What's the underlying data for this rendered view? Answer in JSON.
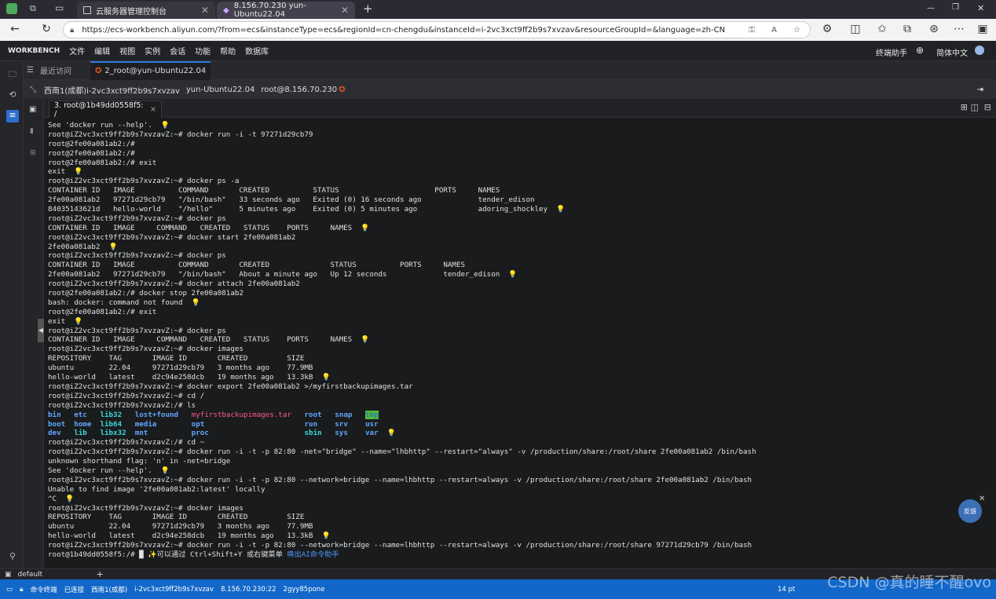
{
  "browser": {
    "tabs": [
      {
        "title": "云服务器管理控制台"
      },
      {
        "title": "8.156.70.230 yun-Ubuntu22.04"
      }
    ],
    "new_tab": "+",
    "window_controls": [
      "—",
      "❐",
      "✕"
    ],
    "url": "https://ecs-workbench.aliyun.com/?from=ecs&instanceType=ecs&regionId=cn-chengdu&instanceId=i-2vc3xct9ff2b9s7xvzav&resourceGroupId=&language=zh-CN"
  },
  "menubar": {
    "brand": "WORKBENCH",
    "items": [
      "文件",
      "编辑",
      "视图",
      "实例",
      "会话",
      "功能",
      "帮助",
      "数据库"
    ],
    "right": [
      "终端助手",
      "简体中文"
    ]
  },
  "session": {
    "recent": "最近访问",
    "tab": "2_root@yun-Ubuntu22.04"
  },
  "infobar": {
    "region": "西南1(成都)i-2vc3xct9ff2b9s7xvzav",
    "host": "yun-Ubuntu22.04",
    "user": "root@8.156.70.230"
  },
  "terminal_tab": {
    "label": "3. root@1b49dd0558f5: /",
    "close": "×"
  },
  "terminal": {
    "lines": [
      [
        {
          "t": "See 'docker run --help'.  "
        },
        {
          "t": "💡",
          "c": "bulb"
        }
      ],
      [
        {
          "t": "root@iZ2vc3xct9ff2b9s7xvzavZ:~# docker run -i -t 97271d29cb79"
        }
      ],
      [
        {
          "t": "root@2fe00a081ab2:/#"
        }
      ],
      [
        {
          "t": "root@2fe00a081ab2:/#"
        }
      ],
      [
        {
          "t": "root@2fe00a081ab2:/# exit"
        }
      ],
      [
        {
          "t": "exit  "
        },
        {
          "t": "💡",
          "c": "bulb"
        }
      ],
      [
        {
          "t": "root@iZ2vc3xct9ff2b9s7xvzavZ:~# docker ps -a"
        }
      ],
      [
        {
          "t": "CONTAINER ID   IMAGE          COMMAND       CREATED          STATUS                      PORTS     NAMES"
        }
      ],
      [
        {
          "t": "2fe00a081ab2   97271d29cb79   \"/bin/bash\"   33 seconds ago   Exited (0) 16 seconds ago             tender_edison"
        }
      ],
      [
        {
          "t": "84035143621d   hello-world    \"/hello\"      5 minutes ago    Exited (0) 5 minutes ago              adoring_shockley  "
        },
        {
          "t": "💡",
          "c": "bulb"
        }
      ],
      [
        {
          "t": "root@iZ2vc3xct9ff2b9s7xvzavZ:~# docker ps"
        }
      ],
      [
        {
          "t": "CONTAINER ID   IMAGE     COMMAND   CREATED   STATUS    PORTS     NAMES  "
        },
        {
          "t": "💡",
          "c": "bulb"
        }
      ],
      [
        {
          "t": "root@iZ2vc3xct9ff2b9s7xvzavZ:~# docker start 2fe00a081ab2"
        }
      ],
      [
        {
          "t": "2fe00a081ab2  "
        },
        {
          "t": "💡",
          "c": "bulb"
        }
      ],
      [
        {
          "t": "root@iZ2vc3xct9ff2b9s7xvzavZ:~# docker ps"
        }
      ],
      [
        {
          "t": "CONTAINER ID   IMAGE          COMMAND       CREATED              STATUS          PORTS     NAMES"
        }
      ],
      [
        {
          "t": "2fe00a081ab2   97271d29cb79   \"/bin/bash\"   About a minute ago   Up 12 seconds             tender_edison  "
        },
        {
          "t": "💡",
          "c": "bulb"
        }
      ],
      [
        {
          "t": "root@iZ2vc3xct9ff2b9s7xvzavZ:~# docker attach 2fe00a081ab2"
        }
      ],
      [
        {
          "t": "root@2fe00a081ab2:/# docker stop 2fe00a081ab2"
        }
      ],
      [
        {
          "t": "bash: docker: command not found  "
        },
        {
          "t": "💡",
          "c": "bulb"
        }
      ],
      [
        {
          "t": "root@2fe00a081ab2:/# exit"
        }
      ],
      [
        {
          "t": "exit  "
        },
        {
          "t": "💡",
          "c": "bulb"
        }
      ],
      [
        {
          "t": "root@iZ2vc3xct9ff2b9s7xvzavZ:~# docker ps"
        }
      ],
      [
        {
          "t": "CONTAINER ID   IMAGE     COMMAND   CREATED   STATUS    PORTS     NAMES  "
        },
        {
          "t": "💡",
          "c": "bulb"
        }
      ],
      [
        {
          "t": "root@iZ2vc3xct9ff2b9s7xvzavZ:~# docker images"
        }
      ],
      [
        {
          "t": "REPOSITORY    TAG       IMAGE ID       CREATED         SIZE"
        }
      ],
      [
        {
          "t": "ubuntu        22.04     97271d29cb79   3 months ago    77.9MB"
        }
      ],
      [
        {
          "t": "hello-world   latest    d2c94e258dcb   19 months ago   13.3kB  "
        },
        {
          "t": "💡",
          "c": "bulb"
        }
      ],
      [
        {
          "t": "root@iZ2vc3xct9ff2b9s7xvzavZ:~# docker export 2fe00a081ab2 >/myfirstbackupimages.tar"
        }
      ],
      [
        {
          "t": "root@iZ2vc3xct9ff2b9s7xvzavZ:~# cd /"
        }
      ],
      [
        {
          "t": "root@iZ2vc3xct9ff2b9s7xvzavZ:/# ls"
        }
      ],
      [
        {
          "t": "bin",
          "c": "dir"
        },
        {
          "t": "   "
        },
        {
          "t": "etc",
          "c": "dir"
        },
        {
          "t": "   "
        },
        {
          "t": "lib32",
          "c": "cyan"
        },
        {
          "t": "   "
        },
        {
          "t": "lost+found",
          "c": "dir"
        },
        {
          "t": "   "
        },
        {
          "t": "myfirstbackupimages.tar",
          "c": "red"
        },
        {
          "t": "   "
        },
        {
          "t": "root",
          "c": "dir"
        },
        {
          "t": "   "
        },
        {
          "t": "snap",
          "c": "dir"
        },
        {
          "t": "   "
        },
        {
          "t": "tmp",
          "c": "hl"
        }
      ],
      [
        {
          "t": "boot",
          "c": "dir"
        },
        {
          "t": "  "
        },
        {
          "t": "home",
          "c": "dir"
        },
        {
          "t": "  "
        },
        {
          "t": "lib64",
          "c": "cyan"
        },
        {
          "t": "   "
        },
        {
          "t": "media",
          "c": "dir"
        },
        {
          "t": "        "
        },
        {
          "t": "opt",
          "c": "dir"
        },
        {
          "t": "                       "
        },
        {
          "t": "run",
          "c": "dir"
        },
        {
          "t": "    "
        },
        {
          "t": "srv",
          "c": "dir"
        },
        {
          "t": "    "
        },
        {
          "t": "usr",
          "c": "dir"
        }
      ],
      [
        {
          "t": "dev",
          "c": "dir"
        },
        {
          "t": "   "
        },
        {
          "t": "lib",
          "c": "cyan"
        },
        {
          "t": "   "
        },
        {
          "t": "libx32",
          "c": "cyan"
        },
        {
          "t": "  "
        },
        {
          "t": "mnt",
          "c": "dir"
        },
        {
          "t": "          "
        },
        {
          "t": "proc",
          "c": "dir"
        },
        {
          "t": "                      "
        },
        {
          "t": "sbin",
          "c": "cyan"
        },
        {
          "t": "   "
        },
        {
          "t": "sys",
          "c": "dir"
        },
        {
          "t": "    "
        },
        {
          "t": "var",
          "c": "dir"
        },
        {
          "t": "  "
        },
        {
          "t": "💡",
          "c": "bulb"
        }
      ],
      [
        {
          "t": "root@iZ2vc3xct9ff2b9s7xvzavZ:/# cd ~"
        }
      ],
      [
        {
          "t": "root@iZ2vc3xct9ff2b9s7xvzavZ:~# docker run -i -t -p 82:80 -net=\"bridge\" --name=\"lhbhttp\" --restart=\"always\" -v /production/share:/root/share 2fe00a081ab2 /bin/bash"
        }
      ],
      [
        {
          "t": "unknown shorthand flag: 'n' in -net=bridge"
        }
      ],
      [
        {
          "t": "See 'docker run --help'.  "
        },
        {
          "t": "💡",
          "c": "bulb"
        }
      ],
      [
        {
          "t": "root@iZ2vc3xct9ff2b9s7xvzavZ:~# docker run -i -t -p 82:80 --network=bridge --name=lhbhttp --restart=always -v /production/share:/root/share 2fe00a081ab2 /bin/bash"
        }
      ],
      [
        {
          "t": "Unable to find image '2fe00a081ab2:latest' locally"
        }
      ],
      [
        {
          "t": "^C  "
        },
        {
          "t": "💡",
          "c": "bulb"
        }
      ],
      [
        {
          "t": "root@iZ2vc3xct9ff2b9s7xvzavZ:~# docker images"
        }
      ],
      [
        {
          "t": "REPOSITORY    TAG       IMAGE ID       CREATED         SIZE"
        }
      ],
      [
        {
          "t": "ubuntu        22.04     97271d29cb79   3 months ago    77.9MB"
        }
      ],
      [
        {
          "t": "hello-world   latest    d2c94e258dcb   19 months ago   13.3kB  "
        },
        {
          "t": "💡",
          "c": "bulb"
        }
      ],
      [
        {
          "t": "root@iZ2vc3xct9ff2b9s7xvzavZ:~# docker run -i -t -p 82:80 --network=bridge --name=lhbhttp --restart=always -v /production/share:/root/share 97271d29cb79 /bin/bash"
        }
      ],
      [
        {
          "t": "root@1b49dd0558f5:/# █ "
        },
        {
          "t": "✨可以通过 Ctrl+Shift+Y 或右键菜单 "
        },
        {
          "t": "唤出AI命令助手",
          "c": "ai"
        }
      ]
    ]
  },
  "bottom": {
    "profile": "default",
    "add": "+"
  },
  "status": {
    "items": [
      "命令终端",
      "已连接",
      "西南1(成都)",
      "i-2vc3xct9ff2b9s7xvzav",
      "8.156.70.230:22",
      "2gyy85pone"
    ],
    "right": "14 pt"
  },
  "fab": {
    "label": "反馈"
  },
  "watermark": "CSDN @真的睡不醒ovo",
  "colors": {
    "accent": "#1267c9",
    "terminal_bg": "#1a1b1d"
  }
}
